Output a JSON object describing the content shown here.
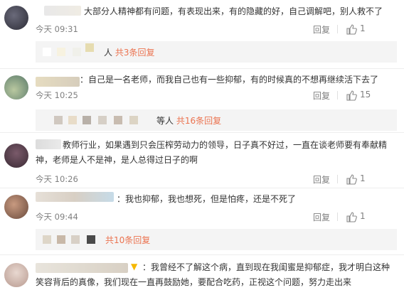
{
  "colors": {
    "link": "#eb7350",
    "muted": "#808080",
    "text": "#333333",
    "vip": "#f5b800"
  },
  "actions": {
    "reply_label": "回复"
  },
  "comments": [
    {
      "text": "大部分人精神都有问题，有表现出来，有的隐藏的好，自己调解吧，别人救不了",
      "time": "今天 09:31",
      "likes": "1",
      "replies": {
        "suffix": "人",
        "link": "共3条回复"
      }
    },
    {
      "text": "：自己是一名老师，而我自己也有一些抑郁，有的时候真的不想再继续活下去了",
      "time": "今天 10:25",
      "likes": "15",
      "replies": {
        "suffix": "等人",
        "link": "共16条回复"
      }
    },
    {
      "text": "教师行业，如果遇到只会压榨劳动力的领导，日子真不好过，一直在谈老师要有奉献精神，老师是人不是神，是人总得过日子的啊",
      "time": "今天 10:26",
      "likes": "1",
      "replies": null
    },
    {
      "text": "：我也抑郁，我也想死，但是怕疼，还是不死了",
      "time": "今天 09:44",
      "likes": "1",
      "replies": {
        "suffix": "",
        "link": "共10条回复"
      }
    },
    {
      "text": "：我曾经不了解这个病，直到现在我闺蜜是抑郁症，我才明白这种笑容背后的真像，我们现在一直再鼓励她，要配合吃药，正视这个问题，努力走出来",
      "time": "",
      "likes": "",
      "replies": null
    }
  ]
}
